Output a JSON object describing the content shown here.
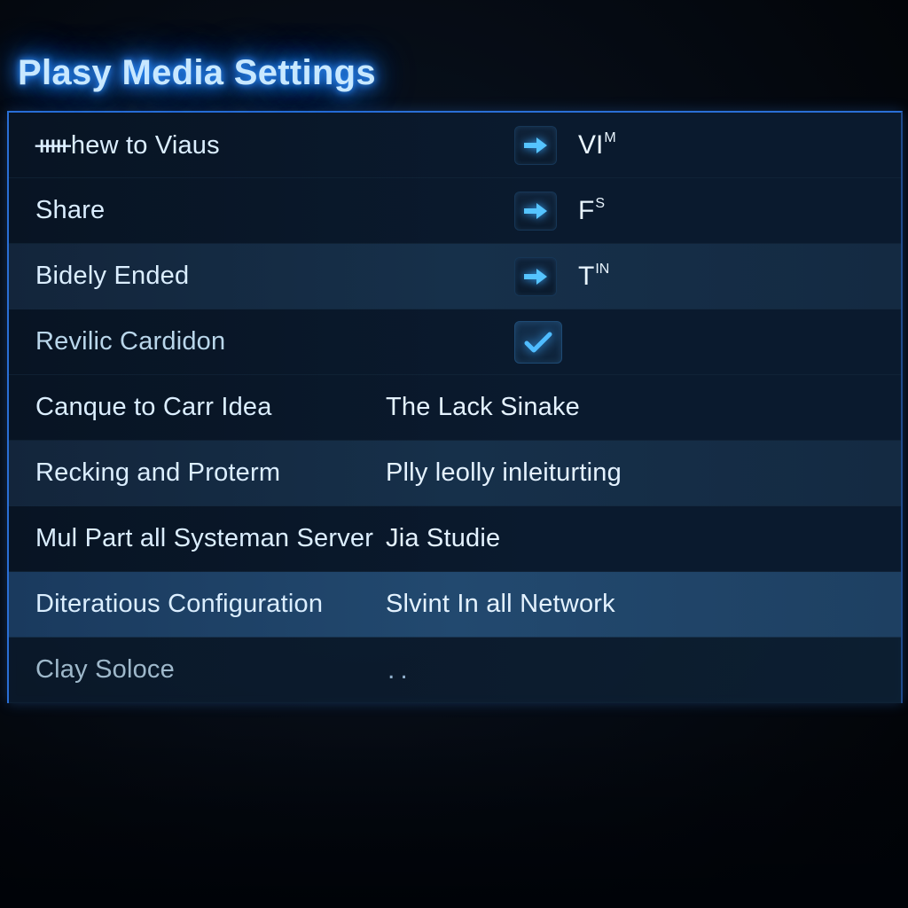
{
  "title": "Plasy Media Settings",
  "rows": [
    {
      "label": "ᚔhew to Viaus",
      "short": "VIᴹ"
    },
    {
      "label": "Share",
      "short": "Fˢ"
    },
    {
      "label": "Bidely Ended",
      "short": "Tᴺ"
    },
    {
      "label": "Revilic Cardidon",
      "checked": true
    },
    {
      "label": "Canque to Carr Idea",
      "value": "The Lack Sinake"
    },
    {
      "label": "Recking and Proterm",
      "value": "Plly leolly inleiturting"
    },
    {
      "label": "Mul Part all Systeman Server",
      "value": "Jia Studie"
    },
    {
      "label": "Diteratious Configuration",
      "value": "Slvint In all Network"
    },
    {
      "label": "Clay Soloce",
      "value": ".."
    }
  ]
}
